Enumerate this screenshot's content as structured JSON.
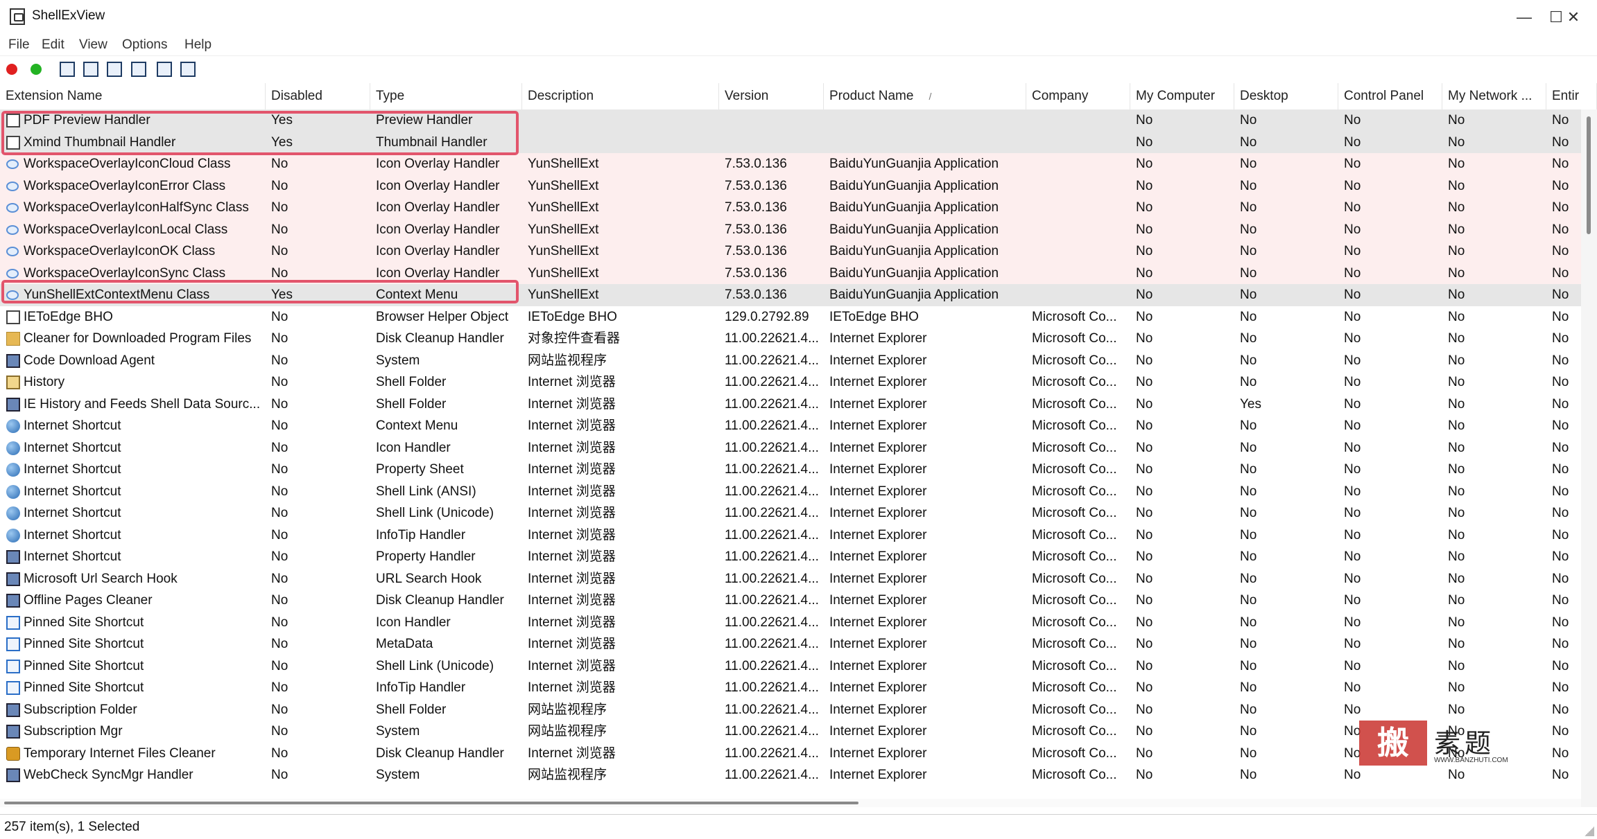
{
  "window": {
    "title": "ShellExView",
    "minimize": "—",
    "maximize": "☐",
    "close": "✕"
  },
  "menu": [
    "File",
    "Edit",
    "View",
    "Options",
    "Help"
  ],
  "toolbar": {
    "icons": [
      "red-dot-icon",
      "green-dot-icon",
      "save-icon",
      "refresh-icon",
      "copy-icon",
      "properties-icon",
      "find-icon",
      "exit-icon"
    ],
    "red": "#e02020",
    "green": "#24b324"
  },
  "columns": [
    "Extension Name",
    "Disabled",
    "Type",
    "Description",
    "Version",
    "Product Name",
    "Company",
    "My Computer",
    "Desktop",
    "Control Panel",
    "My Network ...",
    "Entir"
  ],
  "sort_indicator": "/",
  "rows": [
    {
      "icon": "doc",
      "name": "PDF Preview Handler",
      "disabled": "Yes",
      "type": "Preview Handler",
      "desc": "",
      "version": "",
      "product": "",
      "company": "",
      "mycomputer": "No",
      "desktop": "No",
      "control": "No",
      "network": "No",
      "entire": "No",
      "style": "sel"
    },
    {
      "icon": "doc",
      "name": "Xmind Thumbnail Handler",
      "disabled": "Yes",
      "type": "Thumbnail Handler",
      "desc": "",
      "version": "",
      "product": "",
      "company": "",
      "mycomputer": "No",
      "desktop": "No",
      "control": "No",
      "network": "No",
      "entire": "No",
      "style": "sel"
    },
    {
      "icon": "cloud",
      "name": "WorkspaceOverlayIconCloud Class",
      "disabled": "No",
      "type": "Icon Overlay Handler",
      "desc": "YunShellExt",
      "version": "7.53.0.136",
      "product": "BaiduYunGuanjia Application",
      "company": "",
      "mycomputer": "No",
      "desktop": "No",
      "control": "No",
      "network": "No",
      "entire": "No",
      "style": "pink"
    },
    {
      "icon": "cloud",
      "name": "WorkspaceOverlayIconError Class",
      "disabled": "No",
      "type": "Icon Overlay Handler",
      "desc": "YunShellExt",
      "version": "7.53.0.136",
      "product": "BaiduYunGuanjia Application",
      "company": "",
      "mycomputer": "No",
      "desktop": "No",
      "control": "No",
      "network": "No",
      "entire": "No",
      "style": "pink"
    },
    {
      "icon": "cloud",
      "name": "WorkspaceOverlayIconHalfSync Class",
      "disabled": "No",
      "type": "Icon Overlay Handler",
      "desc": "YunShellExt",
      "version": "7.53.0.136",
      "product": "BaiduYunGuanjia Application",
      "company": "",
      "mycomputer": "No",
      "desktop": "No",
      "control": "No",
      "network": "No",
      "entire": "No",
      "style": "pink"
    },
    {
      "icon": "cloud",
      "name": "WorkspaceOverlayIconLocal Class",
      "disabled": "No",
      "type": "Icon Overlay Handler",
      "desc": "YunShellExt",
      "version": "7.53.0.136",
      "product": "BaiduYunGuanjia Application",
      "company": "",
      "mycomputer": "No",
      "desktop": "No",
      "control": "No",
      "network": "No",
      "entire": "No",
      "style": "pink"
    },
    {
      "icon": "cloud",
      "name": "WorkspaceOverlayIconOK Class",
      "disabled": "No",
      "type": "Icon Overlay Handler",
      "desc": "YunShellExt",
      "version": "7.53.0.136",
      "product": "BaiduYunGuanjia Application",
      "company": "",
      "mycomputer": "No",
      "desktop": "No",
      "control": "No",
      "network": "No",
      "entire": "No",
      "style": "pink"
    },
    {
      "icon": "cloud",
      "name": "WorkspaceOverlayIconSync Class",
      "disabled": "No",
      "type": "Icon Overlay Handler",
      "desc": "YunShellExt",
      "version": "7.53.0.136",
      "product": "BaiduYunGuanjia Application",
      "company": "",
      "mycomputer": "No",
      "desktop": "No",
      "control": "No",
      "network": "No",
      "entire": "No",
      "style": "pink"
    },
    {
      "icon": "cloud",
      "name": "YunShellExtContextMenu Class",
      "disabled": "Yes",
      "type": "Context Menu",
      "desc": "YunShellExt",
      "version": "7.53.0.136",
      "product": "BaiduYunGuanjia Application",
      "company": "",
      "mycomputer": "No",
      "desktop": "No",
      "control": "No",
      "network": "No",
      "entire": "No",
      "style": "sel"
    },
    {
      "icon": "doc",
      "name": "IEToEdge BHO",
      "disabled": "No",
      "type": "Browser Helper Object",
      "desc": "IEToEdge BHO",
      "version": "129.0.2792.89",
      "product": "IEToEdge BHO",
      "company": "Microsoft Co...",
      "mycomputer": "No",
      "desktop": "No",
      "control": "No",
      "network": "No",
      "entire": "No",
      "style": ""
    },
    {
      "icon": "folder",
      "name": "Cleaner for Downloaded Program Files",
      "disabled": "No",
      "type": "Disk Cleanup Handler",
      "desc": "对象控件查看器",
      "version": "11.00.22621.4...",
      "product": "Internet Explorer",
      "company": "Microsoft Co...",
      "mycomputer": "No",
      "desktop": "No",
      "control": "No",
      "network": "No",
      "entire": "No",
      "style": ""
    },
    {
      "icon": "app",
      "name": "Code Download Agent",
      "disabled": "No",
      "type": "System",
      "desc": "网站监视程序",
      "version": "11.00.22621.4...",
      "product": "Internet Explorer",
      "company": "Microsoft Co...",
      "mycomputer": "No",
      "desktop": "No",
      "control": "No",
      "network": "No",
      "entire": "No",
      "style": ""
    },
    {
      "icon": "hist",
      "name": "History",
      "disabled": "No",
      "type": "Shell Folder",
      "desc": "Internet 浏览器",
      "version": "11.00.22621.4...",
      "product": "Internet Explorer",
      "company": "Microsoft Co...",
      "mycomputer": "No",
      "desktop": "No",
      "control": "No",
      "network": "No",
      "entire": "No",
      "style": ""
    },
    {
      "icon": "app",
      "name": "IE History and Feeds Shell Data Sourc...",
      "disabled": "No",
      "type": "Shell Folder",
      "desc": "Internet 浏览器",
      "version": "11.00.22621.4...",
      "product": "Internet Explorer",
      "company": "Microsoft Co...",
      "mycomputer": "No",
      "desktop": "Yes",
      "control": "No",
      "network": "No",
      "entire": "No",
      "style": ""
    },
    {
      "icon": "globe",
      "name": "Internet Shortcut",
      "disabled": "No",
      "type": "Context Menu",
      "desc": "Internet 浏览器",
      "version": "11.00.22621.4...",
      "product": "Internet Explorer",
      "company": "Microsoft Co...",
      "mycomputer": "No",
      "desktop": "No",
      "control": "No",
      "network": "No",
      "entire": "No",
      "style": ""
    },
    {
      "icon": "globe",
      "name": "Internet Shortcut",
      "disabled": "No",
      "type": "Icon Handler",
      "desc": "Internet 浏览器",
      "version": "11.00.22621.4...",
      "product": "Internet Explorer",
      "company": "Microsoft Co...",
      "mycomputer": "No",
      "desktop": "No",
      "control": "No",
      "network": "No",
      "entire": "No",
      "style": ""
    },
    {
      "icon": "globe",
      "name": "Internet Shortcut",
      "disabled": "No",
      "type": "Property Sheet",
      "desc": "Internet 浏览器",
      "version": "11.00.22621.4...",
      "product": "Internet Explorer",
      "company": "Microsoft Co...",
      "mycomputer": "No",
      "desktop": "No",
      "control": "No",
      "network": "No",
      "entire": "No",
      "style": ""
    },
    {
      "icon": "globe",
      "name": "Internet Shortcut",
      "disabled": "No",
      "type": "Shell Link (ANSI)",
      "desc": "Internet 浏览器",
      "version": "11.00.22621.4...",
      "product": "Internet Explorer",
      "company": "Microsoft Co...",
      "mycomputer": "No",
      "desktop": "No",
      "control": "No",
      "network": "No",
      "entire": "No",
      "style": ""
    },
    {
      "icon": "globe",
      "name": "Internet Shortcut",
      "disabled": "No",
      "type": "Shell Link (Unicode)",
      "desc": "Internet 浏览器",
      "version": "11.00.22621.4...",
      "product": "Internet Explorer",
      "company": "Microsoft Co...",
      "mycomputer": "No",
      "desktop": "No",
      "control": "No",
      "network": "No",
      "entire": "No",
      "style": ""
    },
    {
      "icon": "globe",
      "name": "Internet Shortcut",
      "disabled": "No",
      "type": "InfoTip Handler",
      "desc": "Internet 浏览器",
      "version": "11.00.22621.4...",
      "product": "Internet Explorer",
      "company": "Microsoft Co...",
      "mycomputer": "No",
      "desktop": "No",
      "control": "No",
      "network": "No",
      "entire": "No",
      "style": ""
    },
    {
      "icon": "app",
      "name": "Internet Shortcut",
      "disabled": "No",
      "type": "Property Handler",
      "desc": "Internet 浏览器",
      "version": "11.00.22621.4...",
      "product": "Internet Explorer",
      "company": "Microsoft Co...",
      "mycomputer": "No",
      "desktop": "No",
      "control": "No",
      "network": "No",
      "entire": "No",
      "style": ""
    },
    {
      "icon": "app",
      "name": "Microsoft Url Search Hook",
      "disabled": "No",
      "type": "URL Search Hook",
      "desc": "Internet 浏览器",
      "version": "11.00.22621.4...",
      "product": "Internet Explorer",
      "company": "Microsoft Co...",
      "mycomputer": "No",
      "desktop": "No",
      "control": "No",
      "network": "No",
      "entire": "No",
      "style": ""
    },
    {
      "icon": "app",
      "name": "Offline Pages Cleaner",
      "disabled": "No",
      "type": "Disk Cleanup Handler",
      "desc": "Internet 浏览器",
      "version": "11.00.22621.4...",
      "product": "Internet Explorer",
      "company": "Microsoft Co...",
      "mycomputer": "No",
      "desktop": "No",
      "control": "No",
      "network": "No",
      "entire": "No",
      "style": ""
    },
    {
      "icon": "ie",
      "name": "Pinned Site Shortcut",
      "disabled": "No",
      "type": "Icon Handler",
      "desc": "Internet 浏览器",
      "version": "11.00.22621.4...",
      "product": "Internet Explorer",
      "company": "Microsoft Co...",
      "mycomputer": "No",
      "desktop": "No",
      "control": "No",
      "network": "No",
      "entire": "No",
      "style": ""
    },
    {
      "icon": "ie",
      "name": "Pinned Site Shortcut",
      "disabled": "No",
      "type": "MetaData",
      "desc": "Internet 浏览器",
      "version": "11.00.22621.4...",
      "product": "Internet Explorer",
      "company": "Microsoft Co...",
      "mycomputer": "No",
      "desktop": "No",
      "control": "No",
      "network": "No",
      "entire": "No",
      "style": ""
    },
    {
      "icon": "ie",
      "name": "Pinned Site Shortcut",
      "disabled": "No",
      "type": "Shell Link (Unicode)",
      "desc": "Internet 浏览器",
      "version": "11.00.22621.4...",
      "product": "Internet Explorer",
      "company": "Microsoft Co...",
      "mycomputer": "No",
      "desktop": "No",
      "control": "No",
      "network": "No",
      "entire": "No",
      "style": ""
    },
    {
      "icon": "ie",
      "name": "Pinned Site Shortcut",
      "disabled": "No",
      "type": "InfoTip Handler",
      "desc": "Internet 浏览器",
      "version": "11.00.22621.4...",
      "product": "Internet Explorer",
      "company": "Microsoft Co...",
      "mycomputer": "No",
      "desktop": "No",
      "control": "No",
      "network": "No",
      "entire": "No",
      "style": ""
    },
    {
      "icon": "app",
      "name": "Subscription Folder",
      "disabled": "No",
      "type": "Shell Folder",
      "desc": "网站监视程序",
      "version": "11.00.22621.4...",
      "product": "Internet Explorer",
      "company": "Microsoft Co...",
      "mycomputer": "No",
      "desktop": "No",
      "control": "No",
      "network": "No",
      "entire": "No",
      "style": ""
    },
    {
      "icon": "app",
      "name": "Subscription Mgr",
      "disabled": "No",
      "type": "System",
      "desc": "网站监视程序",
      "version": "11.00.22621.4...",
      "product": "Internet Explorer",
      "company": "Microsoft Co...",
      "mycomputer": "No",
      "desktop": "No",
      "control": "No",
      "network": "No",
      "entire": "No",
      "style": ""
    },
    {
      "icon": "lock",
      "name": "Temporary Internet Files Cleaner",
      "disabled": "No",
      "type": "Disk Cleanup Handler",
      "desc": "Internet 浏览器",
      "version": "11.00.22621.4...",
      "product": "Internet Explorer",
      "company": "Microsoft Co...",
      "mycomputer": "No",
      "desktop": "No",
      "control": "No",
      "network": "No",
      "entire": "No",
      "style": ""
    },
    {
      "icon": "app",
      "name": "WebCheck SyncMgr Handler",
      "disabled": "No",
      "type": "System",
      "desc": "网站监视程序",
      "version": "11.00.22621.4...",
      "product": "Internet Explorer",
      "company": "Microsoft Co...",
      "mycomputer": "No",
      "desktop": "No",
      "control": "No",
      "network": "No",
      "entire": "No",
      "style": ""
    }
  ],
  "status": "257 item(s), 1 Selected",
  "watermark": {
    "stamp": "搬",
    "text": "素题",
    "sub": "WWW.BANZHUTI.COM"
  },
  "colors": {
    "highlight_border": "#e2556c",
    "pink_row": "#fdeeee",
    "selected_row": "#e6e6e6"
  }
}
